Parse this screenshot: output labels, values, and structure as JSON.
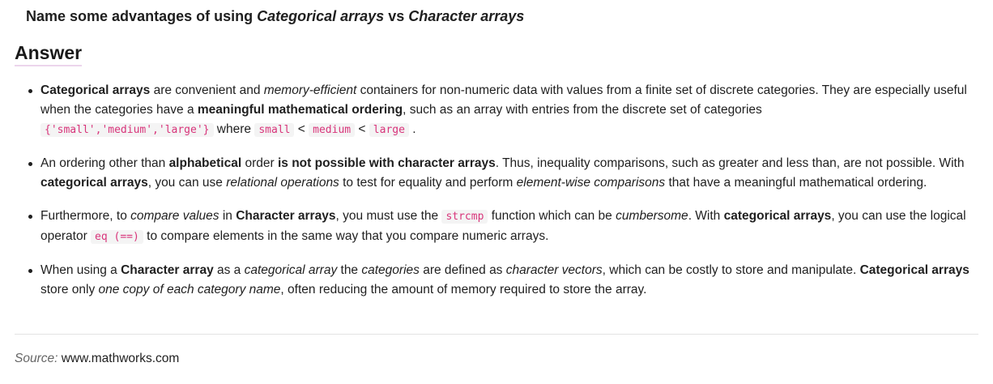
{
  "question": {
    "prefix": "Name some advantages of using ",
    "term1": "Categorical arrays",
    "mid": " vs ",
    "term2": "Character arrays"
  },
  "answer_heading": "Answer",
  "bullets": [
    {
      "t1": "Categorical arrays",
      "t2": " are convenient and ",
      "t3": "memory-efficient",
      "t4": " containers for non-numeric data with values from a finite set of discrete categories. They are especially useful when the categories have a ",
      "t5": "meaningful mathematical ordering",
      "t6": ", such as an array with entries from the discrete set of categories ",
      "code1": "{'small','medium','large'}",
      "t7": " where ",
      "code2": "small",
      "t8": " < ",
      "code3": "medium",
      "t9": " < ",
      "code4": "large",
      "t10": " ."
    },
    {
      "t1": "An ordering other than ",
      "t2": "alphabetical",
      "t3": " order ",
      "t4": "is not possible with character arrays",
      "t5": ". Thus, inequality comparisons, such as greater and less than, are not possible. With ",
      "t6": "categorical arrays",
      "t7": ", you can use ",
      "t8": "relational operations",
      "t9": " to test for equality and perform ",
      "t10": "element-wise comparisons",
      "t11": " that have a meaningful mathematical ordering."
    },
    {
      "t1": "Furthermore, to ",
      "t2": "compare values",
      "t3": " in ",
      "t4": "Character arrays",
      "t5": ", you must use the ",
      "code1": "strcmp",
      "t6": " function which can be ",
      "t7": "cumbersome",
      "t8": ". With ",
      "t9": "categorical arrays",
      "t10": ", you can use the logical operator ",
      "code2": "eq (==)",
      "t11": " to compare elements in the same way that you compare numeric arrays."
    },
    {
      "t1": "When using a ",
      "t2": "Character array",
      "t3": " as a ",
      "t4": "categorical array",
      "t5": " the ",
      "t6": "categories",
      "t7": " are defined as ",
      "t8": "character vectors",
      "t9": ", which can be costly to store and manipulate. ",
      "t10": "Categorical arrays",
      "t11": " store only ",
      "t12": "one copy of each category name",
      "t13": ", often reducing the amount of memory required to store the array."
    }
  ],
  "source": {
    "label": "Source:",
    "url": "www.mathworks.com"
  }
}
